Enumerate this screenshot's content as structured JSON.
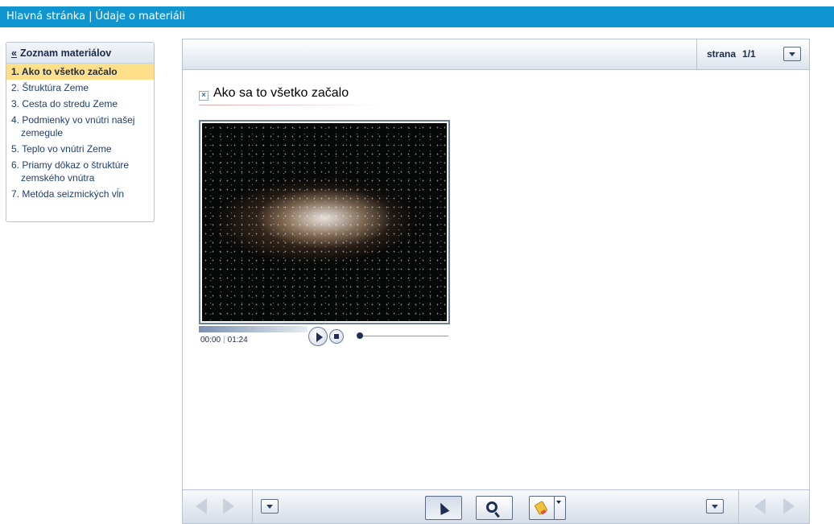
{
  "topbar": {
    "home_label": "Hlavná stránka",
    "separator": "|",
    "details_label": "Údaje o materiáli"
  },
  "sidebar": {
    "back_symbol": "«",
    "title": "Zoznam materiálov",
    "items": [
      {
        "line1": "1. Ako to všetko začalo",
        "line2": "",
        "active": true
      },
      {
        "line1": "2. Štruktúra Zeme",
        "line2": ""
      },
      {
        "line1": "3. Cesta do stredu Zeme",
        "line2": ""
      },
      {
        "line1": "4. Podmienky vo vnútri našej",
        "line2": "zemegule"
      },
      {
        "line1": "5. Teplo vo vnútri Zeme",
        "line2": ""
      },
      {
        "line1": "6. Priamy dôkaz o štruktúre",
        "line2": "zemského vnútra"
      },
      {
        "line1": "7. Metóda seizmických vĺn",
        "line2": ""
      }
    ]
  },
  "header": {
    "page_label": "strana",
    "page_value": "1/1"
  },
  "content": {
    "close_glyph": "×",
    "title": "Ako sa to všetko začalo"
  },
  "player": {
    "current_time": "00:00",
    "time_divider": "|",
    "duration": "01:24",
    "progress": 0
  },
  "colors": {
    "topbar": "#0f95cf",
    "active_item": "#ffe08a",
    "border": "#b8c4d6"
  },
  "icons": [
    "close-icon",
    "chevron-down-icon",
    "play-icon",
    "stop-icon",
    "arrow-left-icon",
    "arrow-right-icon",
    "pointer-icon",
    "magnifier-icon",
    "marker-icon"
  ]
}
